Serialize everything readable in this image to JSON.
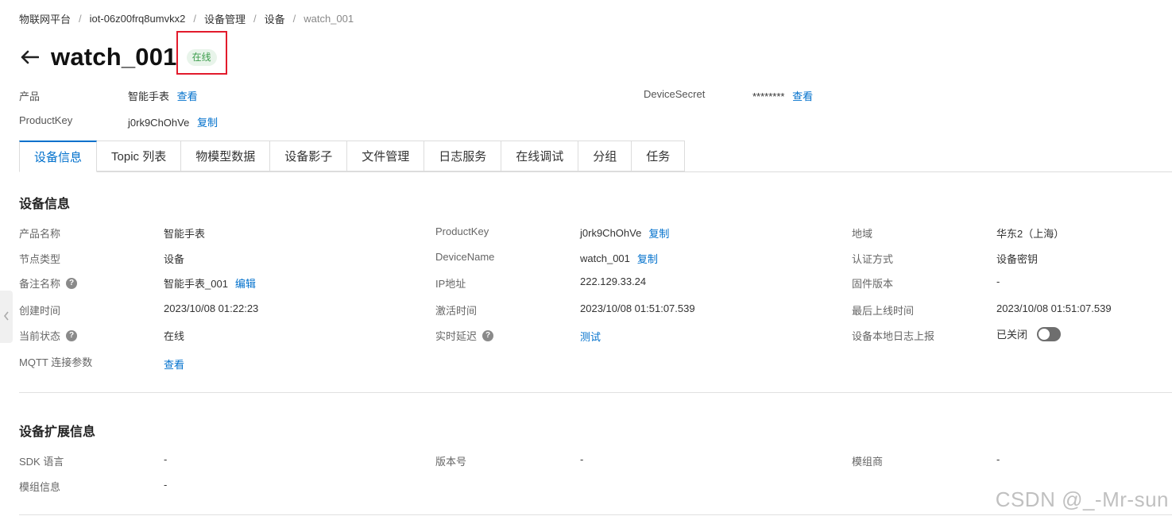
{
  "breadcrumb": [
    "物联网平台",
    "iot-06z00frq8umvkx2",
    "设备管理",
    "设备",
    "watch_001"
  ],
  "header": {
    "title": "watch_001",
    "status": "在线"
  },
  "meta": {
    "product_label": "产品",
    "product_value": "智能手表",
    "product_link": "查看",
    "productkey_label": "ProductKey",
    "productkey_value": "j0rk9ChOhVe",
    "productkey_link": "复制",
    "secret_label": "DeviceSecret",
    "secret_value": "********",
    "secret_link": "查看"
  },
  "tabs": [
    "设备信息",
    "Topic 列表",
    "物模型数据",
    "设备影子",
    "文件管理",
    "日志服务",
    "在线调试",
    "分组",
    "任务"
  ],
  "device_info": {
    "title": "设备信息",
    "col1": [
      {
        "label": "产品名称",
        "value": "智能手表"
      },
      {
        "label": "节点类型",
        "value": "设备"
      },
      {
        "label": "备注名称",
        "value": "智能手表_001",
        "link": "编辑"
      },
      {
        "label": "创建时间",
        "value": "2023/10/08 01:22:23"
      },
      {
        "label": "当前状态",
        "value": "在线"
      },
      {
        "label": "MQTT 连接参数",
        "link": "查看"
      }
    ],
    "col2": [
      {
        "label": "ProductKey",
        "value": "j0rk9ChOhVe",
        "link": "复制"
      },
      {
        "label": "DeviceName",
        "value": "watch_001",
        "link": "复制"
      },
      {
        "label": "IP地址",
        "value": "222.129.33.24"
      },
      {
        "label": "激活时间",
        "value": "2023/10/08 01:51:07.539"
      },
      {
        "label": "实时延迟",
        "link": "测试"
      }
    ],
    "col3": [
      {
        "label": "地域",
        "value": "华东2（上海）"
      },
      {
        "label": "认证方式",
        "value": "设备密钥"
      },
      {
        "label": "固件版本",
        "value": "-"
      },
      {
        "label": "最后上线时间",
        "value": "2023/10/08 01:51:07.539"
      },
      {
        "label": "设备本地日志上报",
        "value": "已关闭"
      }
    ],
    "help_glyph": "?"
  },
  "ext_info": {
    "title": "设备扩展信息",
    "items": [
      {
        "label": "SDK 语言",
        "value": "-"
      },
      {
        "label": "版本号",
        "value": "-"
      },
      {
        "label": "模组商",
        "value": "-"
      },
      {
        "label": "模组信息",
        "value": "-"
      }
    ]
  },
  "watermark": "CSDN @_-Mr-sun",
  "colors": {
    "accent": "#0070cc",
    "status_green": "#3c9d4c",
    "highlight_red": "#e21b2c"
  }
}
